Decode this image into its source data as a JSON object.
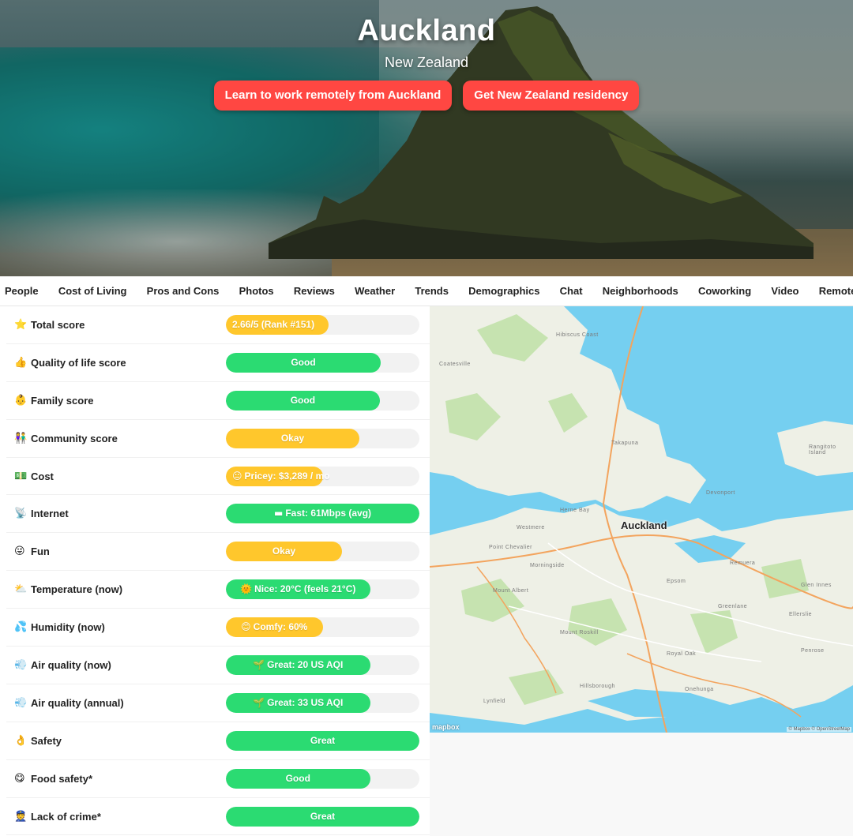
{
  "hero": {
    "title": "Auckland",
    "country": "New Zealand",
    "buttons": [
      "Learn to work remotely from Auckland",
      "Get New Zealand residency"
    ]
  },
  "tabs": [
    "People",
    "Cost of Living",
    "Pros and Cons",
    "Photos",
    "Reviews",
    "Weather",
    "Trends",
    "Demographics",
    "Chat",
    "Neighborhoods",
    "Coworking",
    "Video",
    "Remote jobs"
  ],
  "scores": [
    {
      "label": "Total score",
      "icon": "star-icon",
      "emoji": "⭐",
      "value": "2.66/5 (Rank #151)",
      "level": 0.53,
      "color": "yellow",
      "align": "left"
    },
    {
      "label": "Quality of life score",
      "icon": "thumbs-up-icon",
      "emoji": "👍",
      "value": "Good",
      "level": 0.8,
      "color": "green"
    },
    {
      "label": "Family score",
      "icon": "baby-icon",
      "emoji": "👶",
      "value": "Good",
      "level": 0.795,
      "color": "green"
    },
    {
      "label": "Community score",
      "icon": "community-icon",
      "emoji": "👫",
      "value": "Okay",
      "level": 0.69,
      "color": "yellow"
    },
    {
      "label": "Cost",
      "icon": "money-icon",
      "emoji": "💵",
      "value": "Pricey: $3,289 / mo",
      "prefix": "😐",
      "level": 0.5,
      "color": "yellow",
      "align": "left"
    },
    {
      "label": "Internet",
      "icon": "internet-icon",
      "emoji": "📡",
      "value": "Fast: 61Mbps (avg)",
      "prefix": "▬",
      "level": 1.0,
      "color": "green"
    },
    {
      "label": "Fun",
      "icon": "fun-icon",
      "emoji": "😜",
      "value": "Okay",
      "level": 0.6,
      "color": "yellow"
    },
    {
      "label": "Temperature (now)",
      "icon": "weather-icon",
      "emoji": "⛅",
      "value": "Nice: 20°C (feels 21°C)",
      "prefix": "🌞",
      "level": 0.745,
      "color": "green"
    },
    {
      "label": "Humidity (now)",
      "icon": "humidity-icon",
      "emoji": "💦",
      "value": "Comfy: 60%",
      "prefix": "😊",
      "level": 0.5,
      "color": "yellow"
    },
    {
      "label": "Air quality (now)",
      "icon": "air-icon",
      "emoji": "💨",
      "value": "Great: 20 US AQI",
      "prefix": "🌱",
      "level": 0.745,
      "color": "green"
    },
    {
      "label": "Air quality (annual)",
      "icon": "air-annual-icon",
      "emoji": "💨",
      "value": "Great: 33 US AQI",
      "prefix": "🌱",
      "level": 0.745,
      "color": "green"
    },
    {
      "label": "Safety",
      "icon": "safety-icon",
      "emoji": "👌",
      "value": "Great",
      "level": 1.0,
      "color": "green"
    },
    {
      "label": "Food safety*",
      "icon": "food-icon",
      "emoji": "😋",
      "value": "Good",
      "level": 0.745,
      "color": "green"
    },
    {
      "label": "Lack of crime*",
      "icon": "police-icon",
      "emoji": "👮",
      "value": "Great",
      "level": 1.0,
      "color": "green"
    }
  ],
  "map": {
    "city_label": "Auckland",
    "attribution": "© Mapbox © OpenStreetMap",
    "logo": "mapbox",
    "places": [
      "Hibiscus Coast",
      "Takapuna",
      "Devonport",
      "Westmere",
      "Point Chevalier",
      "Morningside",
      "Mount Albert",
      "Epsom",
      "Greenlane",
      "Remuera",
      "Royal Oak",
      "Onehunga",
      "Penrose",
      "Hillsborough",
      "Lynfield",
      "Ellerslie",
      "Coatesville",
      "Herne Bay",
      "Glen Innes",
      "Mount Roskill",
      "Rangitoto Island"
    ]
  },
  "colors": {
    "accent": "#ff4742",
    "good": "#2bdb72",
    "okay": "#ffc72c",
    "water": "#75cff0",
    "land": "#f2f2ee"
  }
}
